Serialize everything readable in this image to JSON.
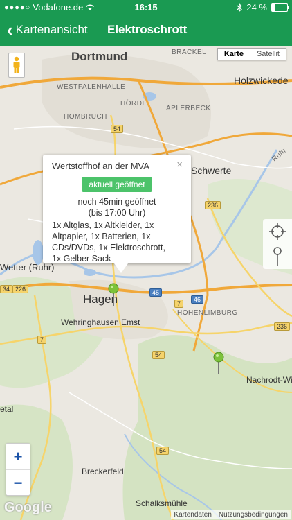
{
  "status_bar": {
    "carrier": "Vodafone.de",
    "time": "16:15",
    "battery_percent": "24 %",
    "battery_level": 0.24
  },
  "nav": {
    "back_label": "Kartenansicht",
    "title": "Elektroschrott"
  },
  "map": {
    "map_type": {
      "map": "Karte",
      "satellite": "Satellit"
    },
    "places": {
      "dortmund": "Dortmund",
      "brackel": "BRACKEL",
      "holzwickede": "Holzwickede",
      "westfalenhalle": "WESTFALENHALLE",
      "horde": "HÖRDE",
      "aplerbeck": "APLERBECK",
      "hombruch": "HOMBRUCH",
      "schwerte": "Schwerte",
      "ruhr": "Ruhr",
      "wetter": "Wetter (Ruhr)",
      "hagen": "Hagen",
      "wehringhausen": "Wehringhausen",
      "emst": "Emst",
      "hohenlimburg": "HOHENLIMBURG",
      "nachrodt": "Nachrodt-Wi",
      "etal": "etal",
      "breckerfeld": "Breckerfeld",
      "schalksmuhle": "Schalksmühle"
    },
    "shields": {
      "s54a": "54",
      "s236a": "236",
      "s34": "34",
      "s226": "226",
      "s45": "45",
      "s46": "46",
      "s7a": "7",
      "s7b": "7",
      "s236b": "236",
      "s54b": "54",
      "s54c": "54"
    },
    "google": "Google",
    "attribution": {
      "data": "Kartendaten",
      "terms": "Nutzungsbedingungen"
    },
    "zoom": {
      "in": "+",
      "out": "−"
    }
  },
  "popup": {
    "title": "Wertstoffhof an der MVA",
    "close": "×",
    "status": "aktuell geöffnet",
    "hours_line1": "noch 45min geöffnet",
    "hours_line2": "(bis 17:00 Uhr)",
    "items_line1": "1x Altglas, 1x Altkleider, 1x",
    "items_line2": "Altpapier, 1x Batterien, 1x",
    "items_line3": "CDs/DVDs, 1x Elektroschrott,",
    "items_line4": "1x Gelber Sack"
  },
  "colors": {
    "brand_green": "#1a9a52",
    "status_green": "#4cc36a",
    "pin_green": "#7cc23a"
  }
}
